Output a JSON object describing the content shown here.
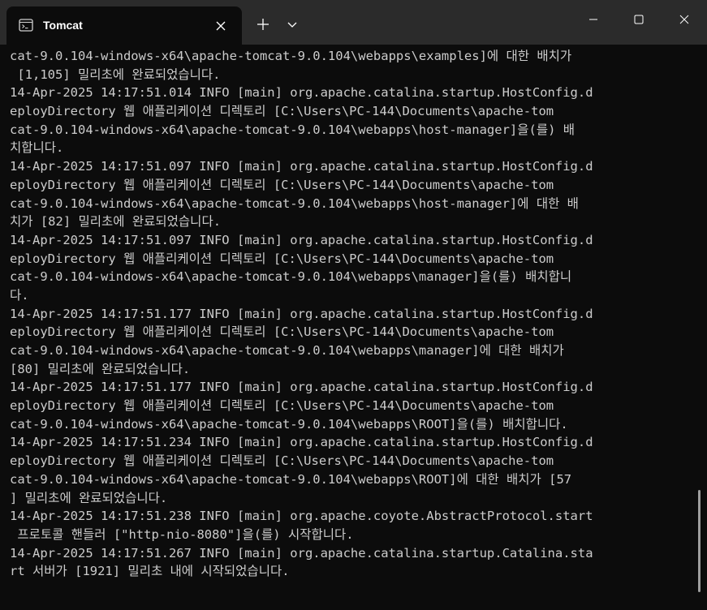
{
  "tab": {
    "title": "Tomcat",
    "icon": "terminal-icon"
  },
  "window": {
    "background": "#0c0c0c",
    "titlebar_color": "#2b2b2b",
    "text_color": "#cccccc"
  },
  "terminal": {
    "lines": [
      "cat-9.0.104-windows-x64\\apache-tomcat-9.0.104\\webapps\\examples]에 대한 배치가",
      " [1,105] 밀리초에 완료되었습니다.",
      "14-Apr-2025 14:17:51.014 INFO [main] org.apache.catalina.startup.HostConfig.d",
      "eployDirectory 웹 애플리케이션 디렉토리 [C:\\Users\\PC-144\\Documents\\apache-tom",
      "cat-9.0.104-windows-x64\\apache-tomcat-9.0.104\\webapps\\host-manager]을(를) 배",
      "치합니다.",
      "14-Apr-2025 14:17:51.097 INFO [main] org.apache.catalina.startup.HostConfig.d",
      "eployDirectory 웹 애플리케이션 디렉토리 [C:\\Users\\PC-144\\Documents\\apache-tom",
      "cat-9.0.104-windows-x64\\apache-tomcat-9.0.104\\webapps\\host-manager]에 대한 배",
      "치가 [82] 밀리초에 완료되었습니다.",
      "14-Apr-2025 14:17:51.097 INFO [main] org.apache.catalina.startup.HostConfig.d",
      "eployDirectory 웹 애플리케이션 디렉토리 [C:\\Users\\PC-144\\Documents\\apache-tom",
      "cat-9.0.104-windows-x64\\apache-tomcat-9.0.104\\webapps\\manager]을(를) 배치합니",
      "다.",
      "14-Apr-2025 14:17:51.177 INFO [main] org.apache.catalina.startup.HostConfig.d",
      "eployDirectory 웹 애플리케이션 디렉토리 [C:\\Users\\PC-144\\Documents\\apache-tom",
      "cat-9.0.104-windows-x64\\apache-tomcat-9.0.104\\webapps\\manager]에 대한 배치가",
      "[80] 밀리초에 완료되었습니다.",
      "14-Apr-2025 14:17:51.177 INFO [main] org.apache.catalina.startup.HostConfig.d",
      "eployDirectory 웹 애플리케이션 디렉토리 [C:\\Users\\PC-144\\Documents\\apache-tom",
      "cat-9.0.104-windows-x64\\apache-tomcat-9.0.104\\webapps\\ROOT]을(를) 배치합니다.",
      "14-Apr-2025 14:17:51.234 INFO [main] org.apache.catalina.startup.HostConfig.d",
      "eployDirectory 웹 애플리케이션 디렉토리 [C:\\Users\\PC-144\\Documents\\apache-tom",
      "cat-9.0.104-windows-x64\\apache-tomcat-9.0.104\\webapps\\ROOT]에 대한 배치가 [57",
      "] 밀리초에 완료되었습니다.",
      "14-Apr-2025 14:17:51.238 INFO [main] org.apache.coyote.AbstractProtocol.start",
      " 프로토콜 핸들러 [\"http-nio-8080\"]을(를) 시작합니다.",
      "14-Apr-2025 14:17:51.267 INFO [main] org.apache.catalina.startup.Catalina.sta",
      "rt 서버가 [1921] 밀리초 내에 시작되었습니다."
    ]
  }
}
